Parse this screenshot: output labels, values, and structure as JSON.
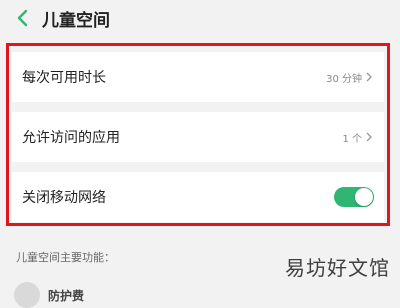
{
  "header": {
    "title": "儿童空间",
    "back_icon": "chevron-left-icon",
    "accent": "#2fb673"
  },
  "settings": {
    "time_limit": {
      "label": "每次可用时长",
      "value": "30 分钟"
    },
    "allowed_apps": {
      "label": "允许访问的应用",
      "value": "1 个"
    },
    "mobile_network": {
      "label": "关闭移动网络",
      "enabled": true
    }
  },
  "highlight_color": "#e0161d",
  "features": {
    "section_title": "儿童空间主要功能：",
    "items": [
      {
        "label": "防护费"
      }
    ]
  },
  "watermark": "易坊好文馆"
}
